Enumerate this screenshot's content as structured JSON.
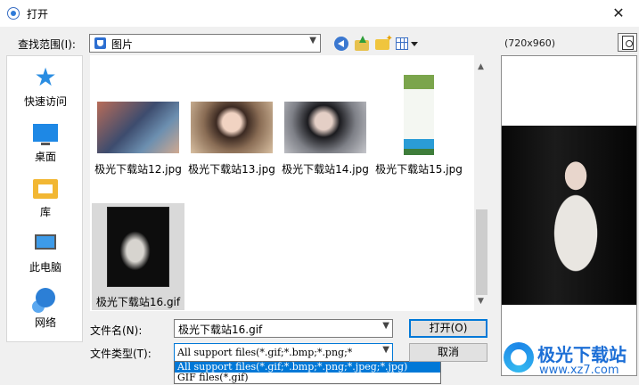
{
  "window": {
    "title": "打开",
    "close_glyph": "✕"
  },
  "lookin": {
    "label": "查找范围(I):",
    "value": "图片"
  },
  "preview": {
    "size_text": "(720x960)"
  },
  "places": [
    {
      "label": "快速访问",
      "icon": "star-icon"
    },
    {
      "label": "桌面",
      "icon": "desktop-icon"
    },
    {
      "label": "库",
      "icon": "library-icon"
    },
    {
      "label": "此电脑",
      "icon": "computer-icon"
    },
    {
      "label": "网络",
      "icon": "network-icon"
    }
  ],
  "files": [
    {
      "name": "极光下载站12.jpg"
    },
    {
      "name": "极光下载站13.jpg"
    },
    {
      "name": "极光下载站14.jpg"
    },
    {
      "name": "极光下载站15.jpg"
    },
    {
      "name": "极光下载站16.gif",
      "selected": true
    }
  ],
  "filename": {
    "label": "文件名(N):",
    "value": "极光下载站16.gif"
  },
  "filetype": {
    "label": "文件类型(T):",
    "value": "All support files(*.gif;*.bmp;*.png;*",
    "options": [
      "All support files(*.gif;*.bmp;*.png;*.jpeg;*.jpg)",
      "GIF files(*.gif)"
    ]
  },
  "buttons": {
    "open": "打开(O)",
    "cancel": "取消"
  },
  "watermark": {
    "text": "极光下载站",
    "url": "www.xz7.com"
  },
  "colors": {
    "accent": "#0078d7",
    "selection": "#d9d9d9"
  }
}
